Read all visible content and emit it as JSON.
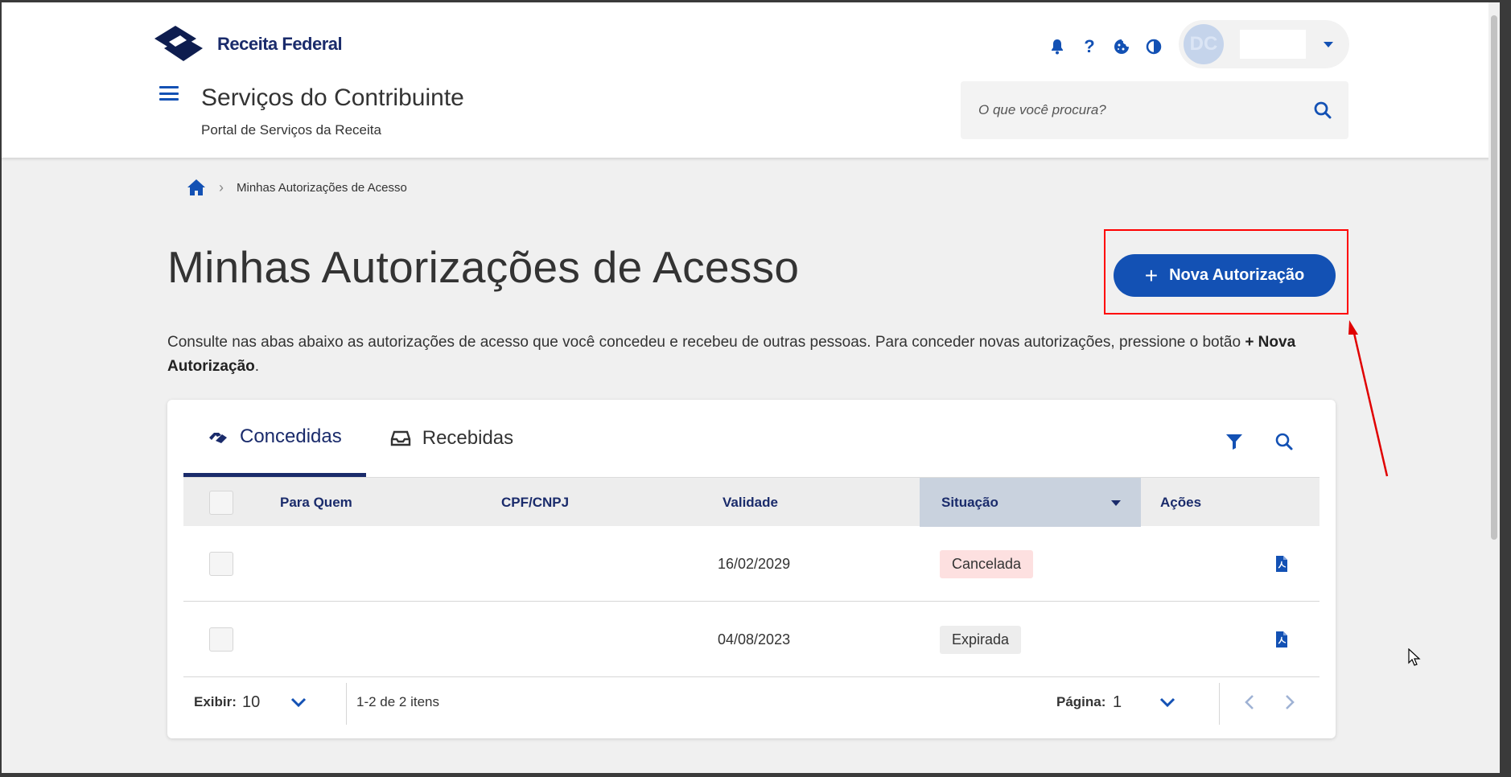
{
  "header": {
    "logo_text": "Receita Federal",
    "site_title": "Serviços do Contribuinte",
    "site_subtitle": "Portal de Serviços da Receita",
    "user_initials": "DC",
    "search_placeholder": "O que você procura?",
    "icons": [
      "bell-icon",
      "help-icon",
      "cookie-icon",
      "contrast-icon"
    ]
  },
  "breadcrumb": {
    "current": "Minhas Autorizações de Acesso"
  },
  "page": {
    "title": "Minhas Autorizações de Acesso",
    "new_button_label": "Nova Autorização",
    "description_before": "Consulte nas abas abaixo as autorizações de acesso que você concedeu e recebeu de outras pessoas. Para conceder novas autorizações, pressione o botão",
    "description_button_ref": "+ Nova Autorização",
    "description_after": "."
  },
  "tabs": [
    {
      "label": "Concedidas",
      "active": true
    },
    {
      "label": "Recebidas",
      "active": false
    }
  ],
  "table": {
    "columns": [
      "Para Quem",
      "CPF/CNPJ",
      "Validade",
      "Situação",
      "Ações"
    ],
    "sorted_column": "Situação",
    "rows": [
      {
        "para_quem": "",
        "cpf_cnpj": "",
        "validade": "16/02/2029",
        "situacao": "Cancelada"
      },
      {
        "para_quem": "",
        "cpf_cnpj": "",
        "validade": "04/08/2023",
        "situacao": "Expirada"
      }
    ]
  },
  "pagination": {
    "show_label": "Exibir:",
    "show_value": "10",
    "range_text": "1-2 de 2 itens",
    "page_label": "Página:",
    "page_value": "1"
  },
  "colors": {
    "primary": "#1351b4",
    "dark_blue": "#1a2b6b",
    "highlight": "#ff0000",
    "badge_cancel_bg": "#fde0e0"
  }
}
